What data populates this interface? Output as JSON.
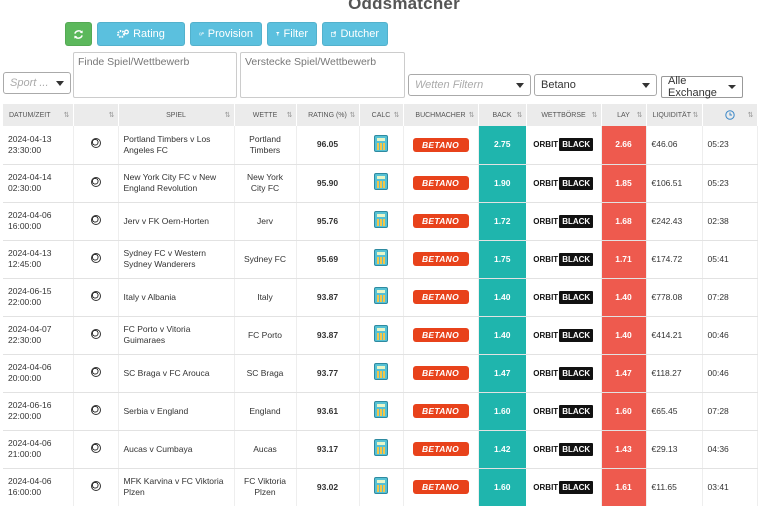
{
  "title": "Oddsmatcher",
  "toolbar": {
    "refresh_icon": "refresh-icon",
    "rating": "Rating",
    "provision": "Provision",
    "filter": "Filter",
    "dutcher": "Dutcher"
  },
  "filters": {
    "sport_placeholder": "Sport ...",
    "find_placeholder": "Finde Spiel/Wettbewerb",
    "hide_placeholder": "Verstecke Spiel/Wettbewerb",
    "bets_placeholder": "Wetten Filtern",
    "bookmaker": "Betano",
    "exchange": "Alle Exchange"
  },
  "columns": [
    "DATUM/ZEIT",
    "",
    "SPIEL",
    "WETTE",
    "RATING (%)",
    "CALC",
    "BUCHMACHER",
    "BACK",
    "WETTBÖRSE",
    "LAY",
    "LIQUIDITÄT",
    ""
  ],
  "bookmaker_logo": "BETANO",
  "exchange_logo": {
    "orbit": "ORBIT",
    "black": "BLACK"
  },
  "rows": [
    {
      "date": "2024-04-13",
      "time": "23:30:00",
      "match": "Portland Timbers v Los Angeles FC",
      "bet": "Portland Timbers",
      "rating": "96.05",
      "back": "2.75",
      "lay": "2.66",
      "liq": "€46.06",
      "t": "05:23"
    },
    {
      "date": "2024-04-14",
      "time": "02:30:00",
      "match": "New York City FC v New England Revolution",
      "bet": "New York City FC",
      "rating": "95.90",
      "back": "1.90",
      "lay": "1.85",
      "liq": "€106.51",
      "t": "05:23"
    },
    {
      "date": "2024-04-06",
      "time": "16:00:00",
      "match": "Jerv v FK Oern-Horten",
      "bet": "Jerv",
      "rating": "95.76",
      "back": "1.72",
      "lay": "1.68",
      "liq": "€242.43",
      "t": "02:38"
    },
    {
      "date": "2024-04-13",
      "time": "12:45:00",
      "match": "Sydney FC v Western Sydney Wanderers",
      "bet": "Sydney FC",
      "rating": "95.69",
      "back": "1.75",
      "lay": "1.71",
      "liq": "€174.72",
      "t": "05:41"
    },
    {
      "date": "2024-06-15",
      "time": "22:00:00",
      "match": "Italy v Albania",
      "bet": "Italy",
      "rating": "93.87",
      "back": "1.40",
      "lay": "1.40",
      "liq": "€778.08",
      "t": "07:28"
    },
    {
      "date": "2024-04-07",
      "time": "22:30:00",
      "match": "FC Porto v Vitoria Guimaraes",
      "bet": "FC Porto",
      "rating": "93.87",
      "back": "1.40",
      "lay": "1.40",
      "liq": "€414.21",
      "t": "00:46"
    },
    {
      "date": "2024-04-06",
      "time": "20:00:00",
      "match": "SC Braga v FC Arouca",
      "bet": "SC Braga",
      "rating": "93.77",
      "back": "1.47",
      "lay": "1.47",
      "liq": "€118.27",
      "t": "00:46"
    },
    {
      "date": "2024-06-16",
      "time": "22:00:00",
      "match": "Serbia v England",
      "bet": "England",
      "rating": "93.61",
      "back": "1.60",
      "lay": "1.60",
      "liq": "€65.45",
      "t": "07:28"
    },
    {
      "date": "2024-04-06",
      "time": "21:00:00",
      "match": "Aucas v Cumbaya",
      "bet": "Aucas",
      "rating": "93.17",
      "back": "1.42",
      "lay": "1.43",
      "liq": "€29.13",
      "t": "04:36"
    },
    {
      "date": "2024-04-06",
      "time": "16:00:00",
      "match": "MFK Karvina v FC Viktoria Plzen",
      "bet": "FC Viktoria Plzen",
      "rating": "93.02",
      "back": "1.60",
      "lay": "1.61",
      "liq": "€11.65",
      "t": "03:41"
    }
  ],
  "colors": {
    "green": "#5cb85c",
    "cyan": "#5bc0de",
    "back": "#1fb5ad",
    "lay": "#ee5a4e",
    "betano": "#e8421b"
  }
}
